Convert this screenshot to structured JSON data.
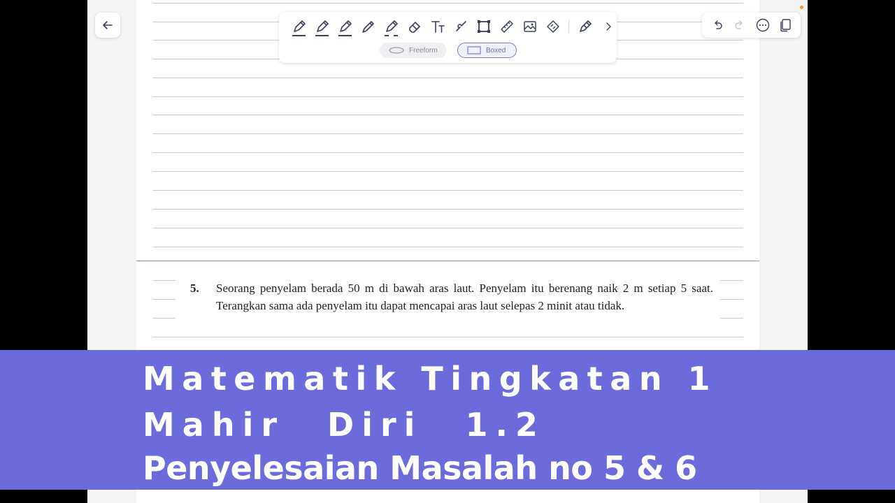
{
  "toolbar": {
    "tools": [
      {
        "name": "pen-1"
      },
      {
        "name": "pen-2"
      },
      {
        "name": "pen-3"
      },
      {
        "name": "pencil"
      },
      {
        "name": "highlighter"
      },
      {
        "name": "eraser"
      },
      {
        "name": "text"
      },
      {
        "name": "lasso"
      },
      {
        "name": "shape-select"
      },
      {
        "name": "ruler"
      },
      {
        "name": "image"
      },
      {
        "name": "sticker"
      },
      {
        "name": "laser-pen"
      }
    ],
    "modes": {
      "freeform": "Freeform",
      "boxed": "Boxed",
      "active": "Boxed"
    }
  },
  "question": {
    "number": "5.",
    "text": "Seorang penyelam berada 50 m di bawah aras laut. Penyelam itu berenang naik 2 m setiap 5 saat. Terangkan sama ada penyelam itu dapat mencapai aras laut selepas 2 minit atau tidak."
  },
  "banner": {
    "line1": "Matematik Tingkatan 1",
    "line2": "Mahir Diri 1.2",
    "line3": "Penyelesaian Masalah no 5 & 6",
    "background_color": "#6b6bdb",
    "text_color": "#ffffff"
  },
  "colors": {
    "icon": "#3a3f5c",
    "accent": "#7b7ec9",
    "notification_dot": "#f0a020"
  }
}
